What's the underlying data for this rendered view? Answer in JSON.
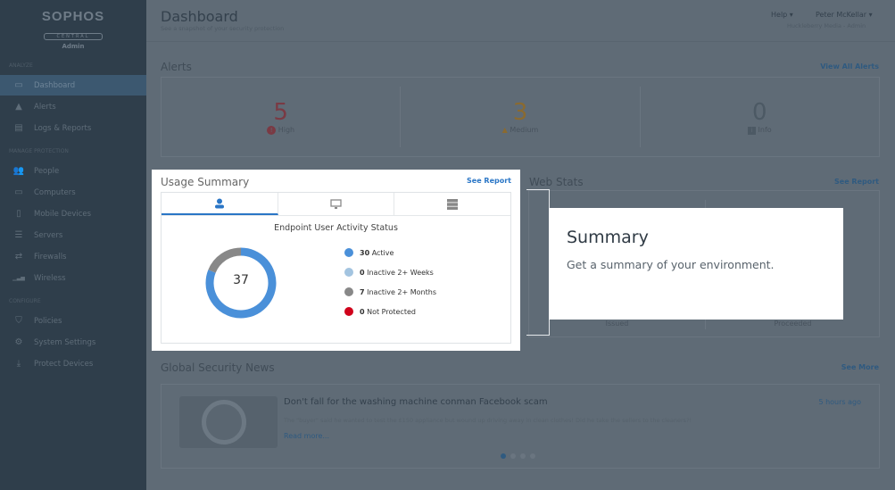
{
  "sidebar": {
    "logo": "SOPHOS",
    "logo_sub": "CENTRAL",
    "role": "Admin",
    "sections": [
      {
        "title": "ANALYZE",
        "items": [
          {
            "label": "Dashboard",
            "icon": "dashboard-icon",
            "selected": true
          },
          {
            "label": "Alerts",
            "icon": "warning-icon"
          },
          {
            "label": "Logs & Reports",
            "icon": "report-icon"
          }
        ]
      },
      {
        "title": "MANAGE PROTECTION",
        "items": [
          {
            "label": "People",
            "icon": "people-icon"
          },
          {
            "label": "Computers",
            "icon": "computer-icon"
          },
          {
            "label": "Mobile Devices",
            "icon": "mobile-icon"
          },
          {
            "label": "Servers",
            "icon": "server-icon"
          },
          {
            "label": "Firewalls",
            "icon": "firewall-icon"
          },
          {
            "label": "Wireless",
            "icon": "wireless-icon"
          }
        ]
      },
      {
        "title": "CONFIGURE",
        "items": [
          {
            "label": "Policies",
            "icon": "shield-icon"
          },
          {
            "label": "System Settings",
            "icon": "gear-icon"
          },
          {
            "label": "Protect Devices",
            "icon": "download-icon"
          }
        ]
      }
    ]
  },
  "header": {
    "title": "Dashboard",
    "subtitle": "See a snapshot of your security protection",
    "help": "Help ▾",
    "user": "Peter McKellar ▾",
    "org": "Huckleberry Media - Admin"
  },
  "alerts": {
    "title": "Alerts",
    "link": "View All Alerts",
    "items": [
      {
        "count": "5",
        "label": "High",
        "color": "#7a3a44"
      },
      {
        "count": "3",
        "label": "Medium",
        "color": "#8a6a30"
      },
      {
        "count": "0",
        "label": "Info",
        "color": "#4c5964"
      }
    ]
  },
  "usage": {
    "title": "Usage Summary",
    "link": "See Report",
    "chart_title": "Endpoint User Activity Status",
    "total": "37",
    "legend": [
      {
        "count": "30",
        "label": "Active",
        "value": 30,
        "color": "#4a90d9"
      },
      {
        "count": "0",
        "label": "Inactive 2+ Weeks",
        "value": 0,
        "color": "#a3c4e0"
      },
      {
        "count": "7",
        "label": "Inactive 2+ Months",
        "value": 7,
        "color": "#888888"
      },
      {
        "count": "0",
        "label": "Not Protected",
        "value": 0,
        "color": "#d0021b"
      }
    ]
  },
  "webstats": {
    "title": "Web Stats",
    "link": "See Report",
    "labels": [
      "Issued",
      "Proceeded"
    ]
  },
  "tooltip": {
    "title": "Summary",
    "text": "Get a summary of your environment."
  },
  "news": {
    "title": "Global Security News",
    "link": "See More",
    "headline": "Don't fall for the washing machine conman Facebook scam",
    "time": "5 hours ago",
    "summary": "The \"buyer\" said he wanted to test the £150 appliance but wound up driving away in clean clothes! Did he take the sellers to the cleaners?!",
    "read_more": "Read more..."
  }
}
